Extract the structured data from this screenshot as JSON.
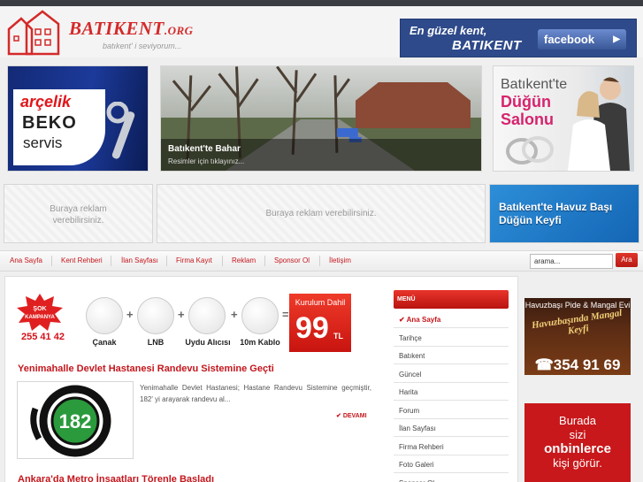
{
  "header": {
    "logo_text": "BATIKENT",
    "logo_suffix": ".ORG",
    "logo_tagline": "batıkent' i seviyorum...",
    "fb_banner_line1": "En güzel kent,",
    "fb_banner_line2": "BATIKENT",
    "fb_button": "facebook"
  },
  "ads": {
    "arcelik_brand": "arçelik",
    "beko_brand": "BEKO",
    "servis": "servis",
    "slider_title": "Batıkent'te Bahar",
    "slider_sub": "Resimler için tıklayınız...",
    "dugun_line1": "Batıkent'te",
    "dugun_line2": "Düğün",
    "dugun_line3": "Salonu",
    "placeholder1_l1": "Buraya reklam",
    "placeholder1_l2": "verebilirsiniz.",
    "placeholder2": "Buraya reklam verebilirsiniz.",
    "havuz_l1": "Batıkent'te Havuz Başı",
    "havuz_l2": "Düğün Keyfi",
    "pide_title": "Havuzbaşı Pide & Mangal Evi",
    "pide_script": "Havuzbaşında Mangal Keyfi",
    "pide_phone": "354 91 69",
    "red_l1": "Burada",
    "red_l2": "sizi",
    "red_l3": "onbinlerce",
    "red_l4": "kişi görür."
  },
  "nav": {
    "items": [
      "Ana Sayfa",
      "Kent Rehberi",
      "İlan Sayfası",
      "Firma Kayıt",
      "Reklam",
      "Sponsor Ol",
      "İletişim"
    ],
    "search_value": "arama...",
    "search_button": "Ara"
  },
  "promo": {
    "burst": "ŞOK KAMPANYA",
    "phone": "255 41 42",
    "items": [
      "Çanak",
      "LNB",
      "Uydu Alıcısı",
      "10m Kablo"
    ],
    "price_label": "Kurulum Dahil",
    "price": "99",
    "currency": "TL"
  },
  "articles": [
    {
      "title": "Yenimahalle Devlet Hastanesi Randevu Sistemine Geçti",
      "excerpt": "Yenimahalle Devlet Hastanesi; Hastane Randevu Sistemine geçmiştir, 182' yi arayarak randevu al...",
      "more": "DEVAMI",
      "thumb_ring": "HASTANE RANDEVU MERKEZİ",
      "thumb_number": "182"
    },
    {
      "title": "Ankara'da Metro İnşaatları Törenle Başladı"
    }
  ],
  "menu": {
    "title": "MENÜ",
    "items": [
      "Ana Sayfa",
      "Tarihçe",
      "Batıkent",
      "Güncel",
      "Harita",
      "Forum",
      "İlan Sayfası",
      "Firma Rehberi",
      "Foto Galeri",
      "Sponsor Ol"
    ]
  },
  "colors": {
    "brand_red": "#c4161c",
    "facebook_blue": "#2e4a8a"
  }
}
